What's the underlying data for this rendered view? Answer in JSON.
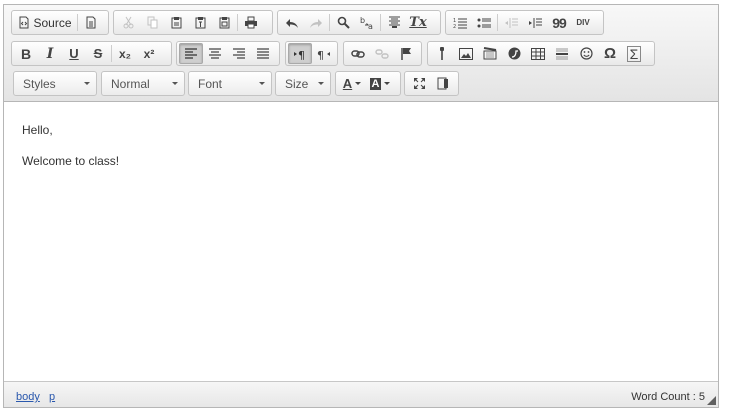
{
  "toolbar": {
    "source_label": "Source",
    "styles_label": "Styles",
    "format_label": "Normal",
    "font_label": "Font",
    "size_label": "Size",
    "bold_label": "B",
    "italic_label": "I",
    "underline_label": "U",
    "strike_label": "S",
    "subscript_label": "x₂",
    "superscript_label": "x²",
    "clear_format_label": "Tx",
    "blockquote_label": "99",
    "div_label": "DIV",
    "omega_label": "Ω",
    "sigma_label": "Σ",
    "text_color_label": "A",
    "bg_color_label": "A"
  },
  "content": {
    "paragraphs": [
      "Hello,",
      "Welcome to class!"
    ]
  },
  "statusbar": {
    "path": [
      "body",
      "p"
    ],
    "word_count": "Word Count : 5"
  }
}
